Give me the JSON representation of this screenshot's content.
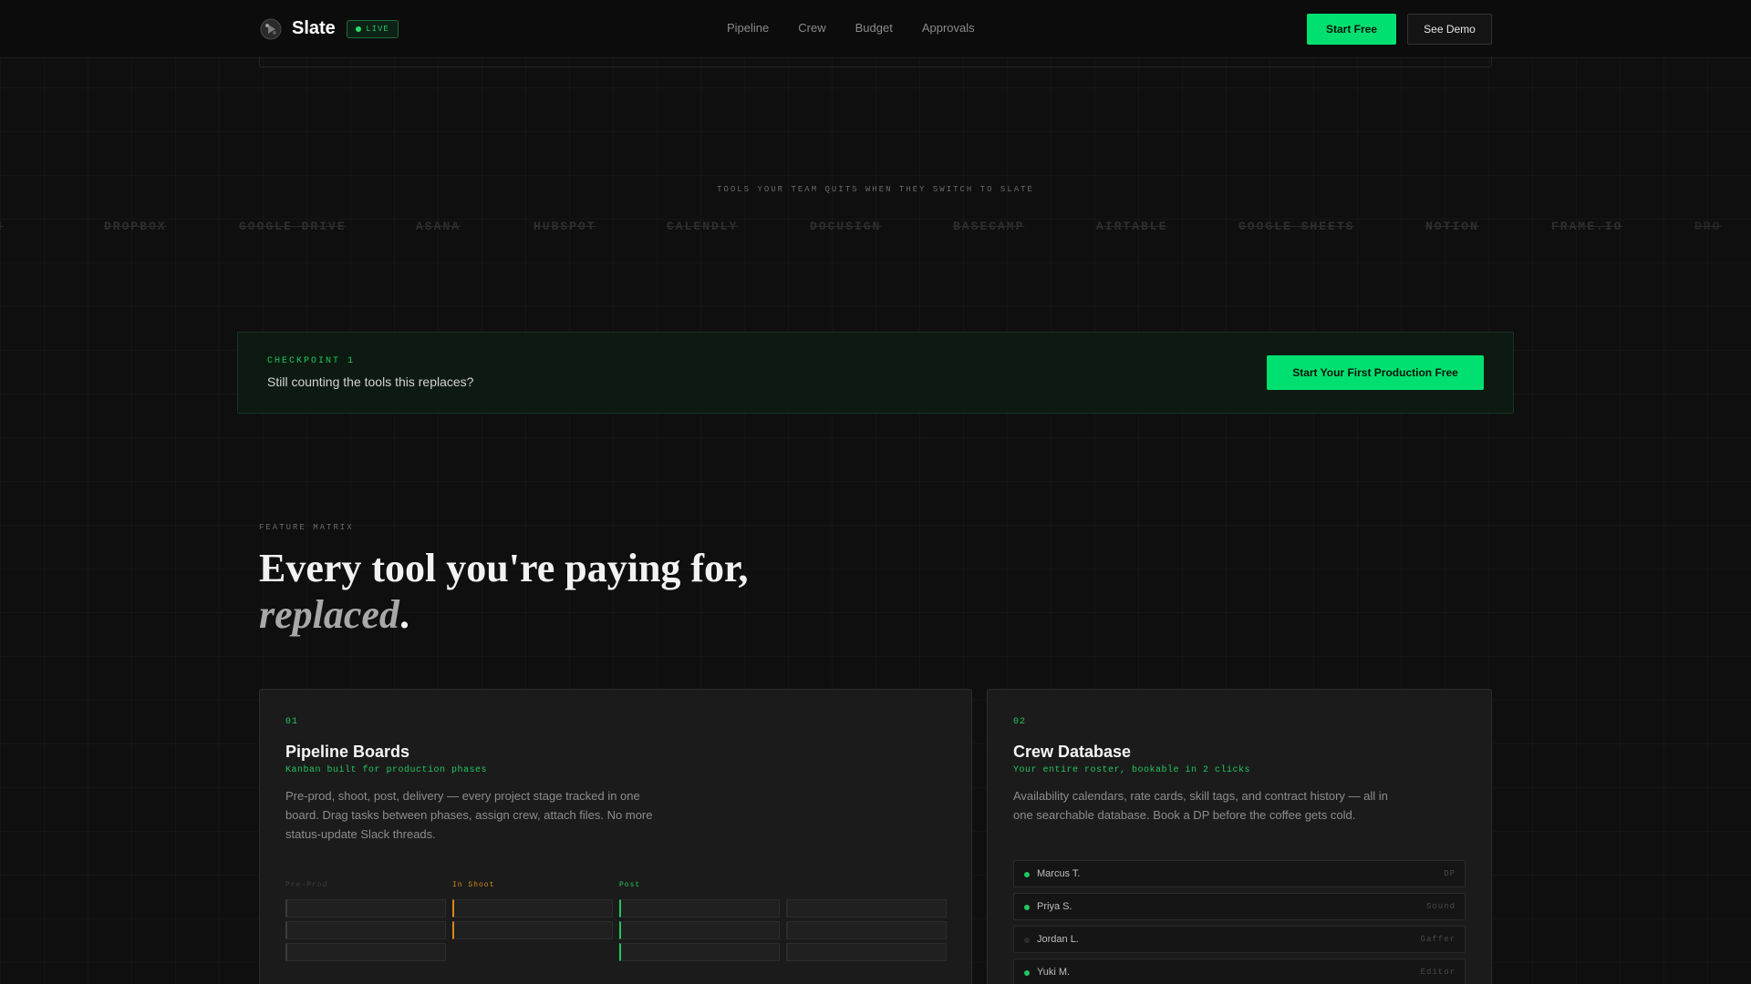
{
  "colors": {
    "accent": "#00e070",
    "accent_text": "#22c55e",
    "in_shoot": "#d98a1a",
    "background": "#0f0f0f"
  },
  "nav": {
    "brand": "Slate",
    "live_badge": "LIVE",
    "links": [
      "Pipeline",
      "Crew",
      "Budget",
      "Approvals"
    ],
    "start_free": "Start Free",
    "see_demo": "See Demo"
  },
  "tools": {
    "title": "TOOLS YOUR TEAM QUITS WHEN THEY SWITCH TO SLATE",
    "items": [
      "DROPBOX",
      "GOOGLE DRIVE",
      "ASANA",
      "HUBSPOT",
      "CALENDLY",
      "DOCUSIGN",
      "BASECAMP",
      "AIRTABLE",
      "GOOGLE SHEETS",
      "NOTION",
      "FRAME.IO"
    ]
  },
  "checkpoint": {
    "label": "CHECKPOINT 1",
    "text": "Still counting the tools this replaces?",
    "cta": "Start Your First Production Free"
  },
  "feature_matrix": {
    "eyebrow": "FEATURE MATRIX",
    "title_line1": "Every tool you're paying for,",
    "title_em": "replaced",
    "title_end": "."
  },
  "cards": [
    {
      "num": "01",
      "replaces": "",
      "title": "Pipeline Boards",
      "subtitle": "Kanban built for production phases",
      "description": "Pre-prod, shoot, post, delivery — every project stage tracked in one board. Drag tasks between phases, assign crew, attach files. No more status-update Slack threads.",
      "columns": [
        {
          "label": "Pre-Prod",
          "cards": 3,
          "color": "#3b3b3b",
          "label_color": "#3e3e3e"
        },
        {
          "label": "In Shoot",
          "cards": 2,
          "color": "#d98a1a",
          "label_color": "#d98a1a"
        },
        {
          "label": "Post",
          "cards": 3,
          "color": "#22c55e",
          "label_color": "#22c55e"
        },
        {
          "label": "",
          "cards": 3,
          "color": "#2c2c2c",
          "label_color": "#2a2a2a"
        }
      ]
    },
    {
      "num": "02",
      "replaces": "",
      "title": "Crew Database",
      "subtitle": "Your entire roster, bookable in 2 clicks",
      "description": "Availability calendars, rate cards, skill tags, and contract history — all in one searchable database. Book a DP before the coffee gets cold.",
      "crew": [
        {
          "name": "Marcus T.",
          "role": "DP",
          "dot": "#22c55e"
        },
        {
          "name": "Priya S.",
          "role": "Sound",
          "dot": "#22c55e"
        },
        {
          "name": "Jordan L.",
          "role": "Gaffer",
          "dot": "#2c2c2c"
        },
        {
          "name": "Yuki M.",
          "role": "Editor",
          "dot": "#22c55e"
        }
      ]
    }
  ]
}
